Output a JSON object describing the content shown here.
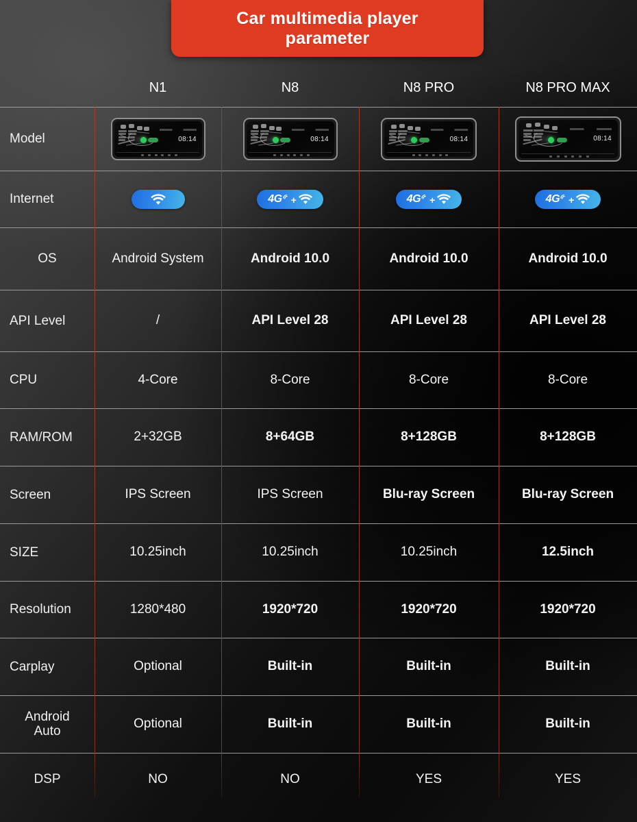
{
  "banner": {
    "title_line1": "Car multimedia player",
    "title_line2": "parameter",
    "color": "#df3b22"
  },
  "theme": {
    "divider_vertical": "#aa3e20",
    "divider_horizontal": "#9a9a9a",
    "badge_gradient_start": "#1f6fe0",
    "badge_gradient_end": "#45b6e8",
    "text": "#f2f2f2"
  },
  "table": {
    "row_label_header": "",
    "columns": [
      "N1",
      "N8",
      "N8 PRO",
      "N8 PRO MAX"
    ],
    "rows": [
      {
        "label": "Model",
        "type": "image",
        "values": [
          "head-unit-n1",
          "head-unit-n8",
          "head-unit-n8-pro",
          "head-unit-n8-pro-max"
        ]
      },
      {
        "label": "Internet",
        "type": "badge",
        "values": [
          "WiFi",
          "4G + WiFi",
          "4G + WiFi",
          "4G + WiFi"
        ],
        "badge_4g_label": "4G",
        "badge_plus_label": "+"
      },
      {
        "label": "OS",
        "type": "text",
        "values": [
          "Android System",
          "Android 10.0",
          "Android 10.0",
          "Android 10.0"
        ],
        "bold": [
          false,
          true,
          true,
          true
        ]
      },
      {
        "label": "API Level",
        "type": "text",
        "values": [
          "/",
          "API Level 28",
          "API Level 28",
          "API Level 28"
        ],
        "bold": [
          false,
          true,
          true,
          true
        ]
      },
      {
        "label": "CPU",
        "type": "text",
        "values": [
          "4-Core",
          "8-Core",
          "8-Core",
          "8-Core"
        ],
        "bold": [
          false,
          false,
          false,
          false
        ]
      },
      {
        "label": "RAM/ROM",
        "type": "text",
        "values": [
          "2+32GB",
          "8+64GB",
          "8+128GB",
          "8+128GB"
        ],
        "bold": [
          false,
          true,
          true,
          true
        ]
      },
      {
        "label": "Screen",
        "type": "text",
        "values": [
          "IPS Screen",
          "IPS Screen",
          "Blu-ray Screen",
          "Blu-ray Screen"
        ],
        "bold": [
          false,
          false,
          true,
          true
        ]
      },
      {
        "label": "SIZE",
        "type": "text",
        "values": [
          "10.25inch",
          "10.25inch",
          "10.25inch",
          "12.5inch"
        ],
        "bold": [
          false,
          false,
          false,
          true
        ]
      },
      {
        "label": "Resolution",
        "type": "text",
        "values": [
          "1280*480",
          "1920*720",
          "1920*720",
          "1920*720"
        ],
        "bold": [
          false,
          true,
          true,
          true
        ]
      },
      {
        "label": "Carplay",
        "type": "text",
        "values": [
          "Optional",
          "Built-in",
          "Built-in",
          "Built-in"
        ],
        "bold": [
          false,
          true,
          true,
          true
        ]
      },
      {
        "label": "Android Auto",
        "label_line1": "Android",
        "label_line2": "Auto",
        "type": "text",
        "values": [
          "Optional",
          "Built-in",
          "Built-in",
          "Built-in"
        ],
        "bold": [
          false,
          true,
          true,
          true
        ]
      },
      {
        "label": "DSP",
        "type": "text",
        "values": [
          "NO",
          "NO",
          "YES",
          "YES"
        ],
        "bold": [
          false,
          false,
          false,
          false
        ]
      }
    ]
  },
  "head_unit": {
    "clock": "08:14"
  }
}
